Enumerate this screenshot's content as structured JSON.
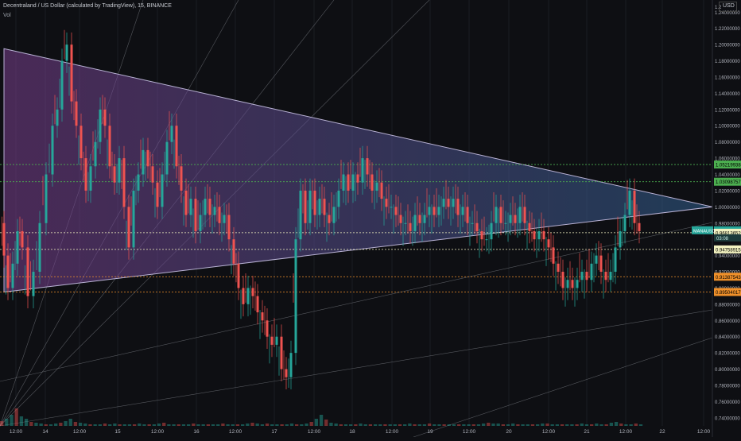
{
  "header": {
    "title": "Decentraland / US Dollar (calculated by TradingView), 15, BINANCE",
    "indicator": "Vol",
    "currency_unit": "USD"
  },
  "chart_data": {
    "type": "candlestick",
    "y_axis": {
      "range": [
        0.73,
        1.255
      ],
      "ticks": [
        1.24,
        1.22,
        1.2,
        1.18,
        1.16,
        1.14,
        1.12,
        1.1,
        1.08,
        1.06,
        1.04,
        1.02,
        1.0,
        0.98,
        0.96,
        0.94,
        0.92,
        0.9,
        0.88,
        0.86,
        0.84,
        0.82,
        0.8,
        0.78,
        0.76,
        0.74
      ],
      "top_partial_label": "1.2"
    },
    "x_axis": {
      "ticks": [
        "12:00",
        "14",
        "12:00",
        "15",
        "12:00",
        "16",
        "12:00",
        "17",
        "12:00",
        "18",
        "12:00",
        "19",
        "12:00",
        "20",
        "12:00",
        "21",
        "12:00",
        "22",
        "12:00"
      ]
    },
    "price_labels": [
      {
        "value": "1.05219938",
        "color": "#4caf50",
        "text_color": "#000000"
      },
      {
        "value": "1.03098757",
        "color": "#4caf50",
        "text_color": "#000000"
      },
      {
        "value": "0.97115787",
        "color": "#26a69a",
        "text_color": "#ffffff"
      },
      {
        "value": "0.96813652",
        "color": "#f2f2c0",
        "text_color": "#000000"
      },
      {
        "value": "0.94758915",
        "color": "#f2f2c0",
        "text_color": "#000000"
      },
      {
        "value": "0.91387543",
        "color": "#f0902a",
        "text_color": "#000000"
      },
      {
        "value": "0.89504017",
        "color": "#f0902a",
        "text_color": "#000000"
      }
    ],
    "symbol_tag": {
      "symbol": "MANAUSD",
      "countdown": "03:08",
      "price": "0.97115787"
    },
    "levels": [
      {
        "value": 1.05219938,
        "color": "#4caf50"
      },
      {
        "value": 1.03098757,
        "color": "#4caf50"
      },
      {
        "value": 0.96813652,
        "color": "#f2f2c0"
      },
      {
        "value": 0.94758915,
        "color": "#f2f2c0"
      },
      {
        "value": 0.91387543,
        "color": "#f0902a"
      },
      {
        "value": 0.89504017,
        "color": "#f0902a"
      }
    ],
    "price_path": [
      [
        0,
        0.98
      ],
      [
        5,
        0.94
      ],
      [
        10,
        0.9
      ],
      [
        16,
        0.93
      ],
      [
        22,
        0.97
      ],
      [
        28,
        0.95
      ],
      [
        35,
        0.89
      ],
      [
        42,
        0.92
      ],
      [
        50,
        0.98
      ],
      [
        58,
        1.04
      ],
      [
        66,
        1.1
      ],
      [
        72,
        1.12
      ],
      [
        78,
        1.18
      ],
      [
        84,
        1.2
      ],
      [
        90,
        1.13
      ],
      [
        96,
        1.1
      ],
      [
        102,
        1.06
      ],
      [
        108,
        1.02
      ],
      [
        114,
        1.05
      ],
      [
        120,
        1.08
      ],
      [
        126,
        1.12
      ],
      [
        132,
        1.1
      ],
      [
        138,
        1.05
      ],
      [
        144,
        1.03
      ],
      [
        150,
        1.06
      ],
      [
        156,
        1.0
      ],
      [
        162,
        0.95
      ],
      [
        168,
        1.02
      ],
      [
        174,
        1.04
      ],
      [
        180,
        1.07
      ],
      [
        186,
        1.05
      ],
      [
        192,
        1.03
      ],
      [
        198,
        1.0
      ],
      [
        204,
        1.04
      ],
      [
        210,
        1.08
      ],
      [
        216,
        1.1
      ],
      [
        222,
        1.05
      ],
      [
        228,
        1.02
      ],
      [
        234,
        0.99
      ],
      [
        240,
        1.01
      ],
      [
        246,
        0.97
      ],
      [
        252,
        0.99
      ],
      [
        258,
        1.01
      ],
      [
        264,
        0.99
      ],
      [
        270,
        1.0
      ],
      [
        276,
        0.98
      ],
      [
        282,
        0.99
      ],
      [
        288,
        0.96
      ],
      [
        294,
        0.93
      ],
      [
        300,
        0.9
      ],
      [
        306,
        0.88
      ],
      [
        312,
        0.9
      ],
      [
        318,
        0.89
      ],
      [
        324,
        0.87
      ],
      [
        330,
        0.86
      ],
      [
        336,
        0.84
      ],
      [
        342,
        0.83
      ],
      [
        348,
        0.84
      ],
      [
        354,
        0.8
      ],
      [
        360,
        0.79
      ],
      [
        366,
        0.82
      ],
      [
        372,
        0.96
      ],
      [
        378,
        1.02
      ],
      [
        384,
        0.98
      ],
      [
        390,
        1.02
      ],
      [
        396,
        0.99
      ],
      [
        402,
        1.01
      ],
      [
        408,
        0.99
      ],
      [
        414,
        0.98
      ],
      [
        420,
        1.0
      ],
      [
        426,
        1.02
      ],
      [
        432,
        1.04
      ],
      [
        438,
        1.02
      ],
      [
        444,
        1.04
      ],
      [
        450,
        1.03
      ],
      [
        456,
        1.06
      ],
      [
        462,
        1.04
      ],
      [
        468,
        1.02
      ],
      [
        474,
        1.03
      ],
      [
        480,
        1.01
      ],
      [
        486,
        1.0
      ],
      [
        492,
        1.0
      ],
      [
        498,
        0.99
      ],
      [
        504,
        0.98
      ],
      [
        510,
        0.98
      ],
      [
        516,
        0.97
      ],
      [
        522,
        0.99
      ],
      [
        528,
        0.98
      ],
      [
        534,
        0.99
      ],
      [
        540,
        1.0
      ],
      [
        546,
        0.99
      ],
      [
        552,
        1.0
      ],
      [
        558,
        1.01
      ],
      [
        564,
        1.0
      ],
      [
        570,
        1.01
      ],
      [
        576,
        0.99
      ],
      [
        582,
        1.0
      ],
      [
        588,
        0.98
      ],
      [
        594,
        0.98
      ],
      [
        600,
        0.97
      ],
      [
        606,
        0.96
      ],
      [
        612,
        0.96
      ],
      [
        618,
        0.98
      ],
      [
        624,
        1.0
      ],
      [
        630,
        0.98
      ],
      [
        636,
        0.98
      ],
      [
        642,
        0.99
      ],
      [
        648,
        0.98
      ],
      [
        654,
        1.0
      ],
      [
        660,
        0.98
      ],
      [
        666,
        0.97
      ],
      [
        672,
        0.96
      ],
      [
        678,
        0.97
      ],
      [
        684,
        0.96
      ],
      [
        690,
        0.95
      ],
      [
        696,
        0.93
      ],
      [
        702,
        0.92
      ],
      [
        708,
        0.9
      ],
      [
        714,
        0.91
      ],
      [
        720,
        0.9
      ],
      [
        726,
        0.91
      ],
      [
        732,
        0.92
      ],
      [
        738,
        0.91
      ],
      [
        744,
        0.93
      ],
      [
        750,
        0.94
      ],
      [
        756,
        0.92
      ],
      [
        762,
        0.91
      ],
      [
        768,
        0.92
      ],
      [
        774,
        0.95
      ],
      [
        780,
        0.97
      ],
      [
        786,
        0.99
      ],
      [
        792,
        1.02
      ],
      [
        798,
        0.98
      ],
      [
        804,
        0.97
      ]
    ],
    "volume_profile": [
      6,
      9,
      14,
      22,
      12,
      9,
      5,
      4,
      3,
      2,
      2,
      3,
      4,
      6,
      9,
      5,
      4,
      3,
      2,
      2,
      2,
      3,
      2,
      3,
      2,
      2,
      2,
      2,
      3,
      2,
      2,
      2,
      3,
      4,
      2,
      2,
      2,
      2,
      2,
      3,
      2,
      2,
      2,
      2,
      2,
      3,
      2,
      2,
      2,
      2,
      3,
      4,
      3,
      2,
      3,
      2,
      2,
      2,
      2,
      3,
      2,
      2,
      3,
      5,
      9,
      14,
      8,
      4,
      3,
      2,
      2,
      2,
      2,
      3,
      2,
      2,
      2,
      2,
      2,
      2,
      2,
      2,
      2,
      3,
      2,
      2,
      2,
      3,
      2,
      2,
      2,
      2,
      2,
      2,
      2,
      2,
      2,
      2,
      3,
      4,
      3,
      3,
      2,
      2,
      3,
      2,
      2,
      2,
      2,
      2,
      3,
      3,
      2,
      2,
      2,
      2,
      2,
      2,
      3,
      2,
      2,
      3,
      2,
      2,
      4,
      5,
      3,
      2,
      2,
      3,
      2
    ],
    "triangle": {
      "apex_x_value": 1.0,
      "upper_start": 1.195,
      "lower_start": 0.895
    },
    "colors": {
      "up": "#26a69a",
      "down": "#ef5350",
      "triangle_left": "#7a3f8e",
      "triangle_right": "#2f5f8c",
      "background": "#0e0f13"
    }
  }
}
